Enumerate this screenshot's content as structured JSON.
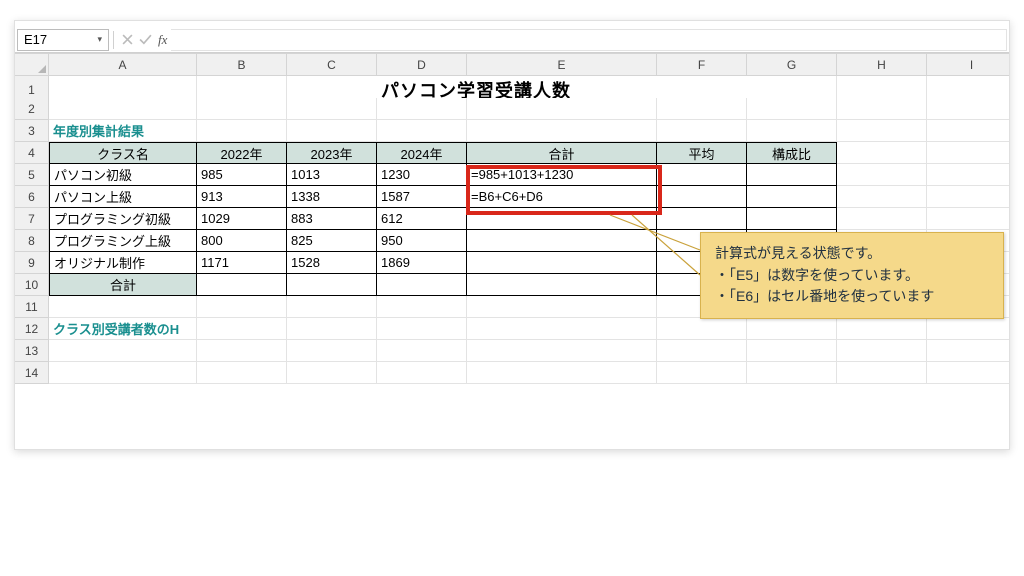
{
  "namebox": "E17",
  "fx_label": "fx",
  "columns": [
    "A",
    "B",
    "C",
    "D",
    "E",
    "F",
    "G",
    "H",
    "I"
  ],
  "rows_visible": 14,
  "title": "パソコン学習受講人数",
  "section_label": "年度別集計結果",
  "headers": {
    "class": "クラス名",
    "y2022": "2022年",
    "y2023": "2023年",
    "y2024": "2024年",
    "total": "合計",
    "avg": "平均",
    "ratio": "構成比"
  },
  "rows": [
    {
      "name": "パソコン初級",
      "y22": "985",
      "y23": "1013",
      "y24": "1230",
      "e": "=985+1013+1230"
    },
    {
      "name": "パソコン上級",
      "y22": "913",
      "y23": "1338",
      "y24": "1587",
      "e": "=B6+C6+D6"
    },
    {
      "name": "プログラミング初級",
      "y22": "1029",
      "y23": "883",
      "y24": "612",
      "e": ""
    },
    {
      "name": "プログラミング上級",
      "y22": "800",
      "y23": "825",
      "y24": "950",
      "e": ""
    },
    {
      "name": "オリジナル制作",
      "y22": "1171",
      "y23": "1528",
      "y24": "1869",
      "e": ""
    }
  ],
  "total_row_label": "合計",
  "row12_label": "クラス別受講者数のH",
  "callout": {
    "line1": "計算式が見える状態です。",
    "line2": "・「E5」は数字を使っています。",
    "line3": "・「E6」はセル番地を使っています"
  }
}
